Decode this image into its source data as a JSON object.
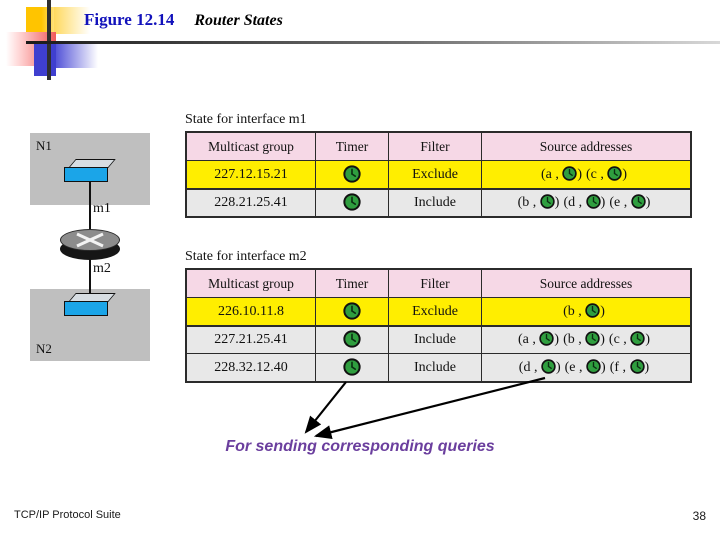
{
  "slide": {
    "title_figure": "Figure 12.14",
    "title_subject": "Router States"
  },
  "diagram": {
    "network_top_label": "N1",
    "network_bottom_label": "N2",
    "interface_top_label": "m1",
    "interface_bottom_label": "m2"
  },
  "tables": [
    {
      "caption": "State for interface m1",
      "columns": [
        "Multicast group",
        "Timer",
        "Filter",
        "Source addresses"
      ],
      "rows": [
        {
          "highlight": true,
          "group": "227.12.15.21",
          "timer": "timer-clock-icon",
          "filter": "Exclude",
          "sources": [
            "a",
            "c"
          ]
        },
        {
          "highlight": false,
          "group": "228.21.25.41",
          "timer": "timer-clock-icon",
          "filter": "Include",
          "sources": [
            "b",
            "d",
            "e"
          ]
        }
      ]
    },
    {
      "caption": "State for interface m2",
      "columns": [
        "Multicast group",
        "Timer",
        "Filter",
        "Source addresses"
      ],
      "rows": [
        {
          "highlight": true,
          "group": "226.10.11.8",
          "timer": "timer-clock-icon",
          "filter": "Exclude",
          "sources": [
            "b"
          ]
        },
        {
          "highlight": false,
          "group": "227.21.25.41",
          "timer": "timer-clock-icon",
          "filter": "Include",
          "sources": [
            "a",
            "b",
            "c"
          ]
        },
        {
          "highlight": false,
          "group": "228.32.12.40",
          "timer": "timer-clock-icon",
          "filter": "Include",
          "sources": [
            "d",
            "e",
            "f"
          ]
        }
      ]
    }
  ],
  "annotation": {
    "caption": "For sending corresponding queries",
    "arrow_count": 2
  },
  "footer": {
    "left": "TCP/IP Protocol Suite",
    "page_number": "38"
  },
  "colors": {
    "title_blue": "#1111bb",
    "header_pink": "#f6d8e6",
    "highlight_yellow": "#ffee00",
    "row_gray": "#e8e8e8",
    "network_gray": "#bfbfbf",
    "host_blue": "#1ba5e8",
    "clock_green": "#2f9e3f",
    "caption_purple": "#6b3f9e"
  }
}
